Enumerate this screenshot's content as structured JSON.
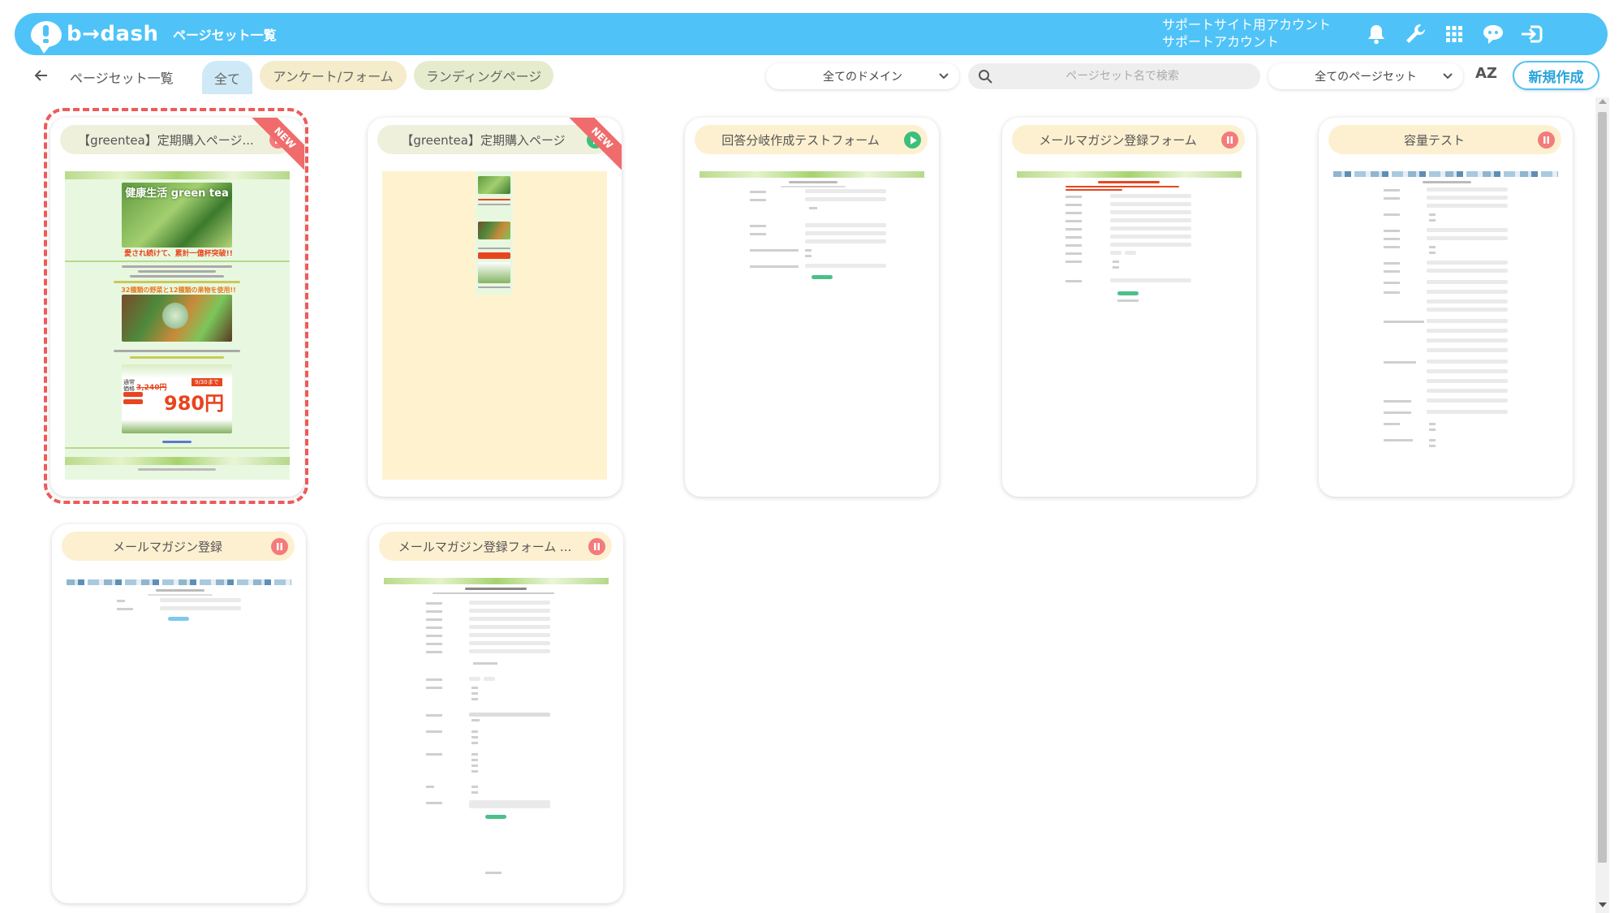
{
  "app": {
    "logo_text": "b→dash",
    "page_title": "ページセット一覧"
  },
  "account": {
    "line1": "サポートサイト用アカウント",
    "line2": "サポートアカウント"
  },
  "header_icons": [
    "bell-icon",
    "wrench-icon",
    "apps-grid-icon",
    "chat-robot-icon",
    "logout-icon"
  ],
  "nav": {
    "breadcrumb": "ページセット一覧",
    "tabs": [
      {
        "label": "全て",
        "active": true
      },
      {
        "label": "アンケート/フォーム",
        "active": false
      },
      {
        "label": "ランディングページ",
        "active": false
      }
    ],
    "domain_select": "全てのドメイン",
    "search_placeholder": "ページセット名で検索",
    "pageset_select": "全てのページセット",
    "sort_label": "AZ",
    "new_button": "新規作成"
  },
  "cards": [
    {
      "title": "【greentea】定期購入ページ...",
      "status": "paused",
      "new": true,
      "ribbon": "NEW",
      "selected": true,
      "thumb": "lp-greentea",
      "thumb_text": {
        "headline": "健康生活 green tea",
        "catch": "愛され続けて、累計一億杯突破!!",
        "veg": "32種類の野菜と12種類の果物を使用!!",
        "price_label": "通常価格",
        "price_old": "3,240円",
        "price": "980円",
        "badge": "9/30まで"
      }
    },
    {
      "title": "【greentea】定期購入ページ",
      "status": "active",
      "new": true,
      "ribbon": "NEW",
      "selected": false,
      "thumb": "lp-greentea-small"
    },
    {
      "title": "回答分岐作成テストフォーム",
      "status": "active",
      "new": false,
      "selected": false,
      "thumb": "form-short"
    },
    {
      "title": "メールマガジン登録フォーム",
      "status": "paused",
      "new": false,
      "selected": false,
      "thumb": "form-mail"
    },
    {
      "title": "容量テスト",
      "status": "paused",
      "new": false,
      "selected": false,
      "thumb": "form-long"
    },
    {
      "title": "メールマガジン登録",
      "status": "paused",
      "new": false,
      "selected": false,
      "thumb": "form-tiny"
    },
    {
      "title": "メールマガジン登録フォーム ...",
      "status": "paused",
      "new": false,
      "selected": false,
      "thumb": "form-mail-long"
    }
  ],
  "colors": {
    "header": "#4fc3f7",
    "pause": "#f47b7b",
    "play": "#3cbf7a",
    "ribbon": "#f06b6b",
    "selection": "#ee5a5a"
  }
}
